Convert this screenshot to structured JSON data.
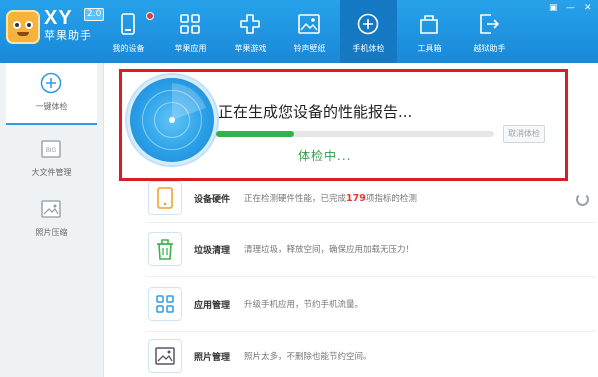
{
  "app": {
    "brand_short": "XY",
    "version": "2.0",
    "brand_name": "苹果助手"
  },
  "nav": [
    {
      "label": "我的设备",
      "icon": "phone-icon",
      "badge": true
    },
    {
      "label": "苹果应用",
      "icon": "apps-grid-icon"
    },
    {
      "label": "苹果游戏",
      "icon": "game-cross-icon"
    },
    {
      "label": "铃声壁纸",
      "icon": "picture-icon"
    },
    {
      "label": "手机体检",
      "icon": "plus-circle-icon",
      "active": true
    },
    {
      "label": "工具箱",
      "icon": "toolbox-icon"
    },
    {
      "label": "越狱助手",
      "icon": "exit-icon"
    }
  ],
  "window_controls": {
    "skin": "▣",
    "minimize": "—",
    "close": "✕"
  },
  "sidebar": [
    {
      "label": "一键体检",
      "icon": "plus-circle-icon",
      "active": true
    },
    {
      "label": "大文件管理",
      "icon": "big-file-icon"
    },
    {
      "label": "照片压缩",
      "icon": "photo-icon"
    }
  ],
  "scan": {
    "title": "正在生成您设备的性能报告...",
    "progress": 0.28,
    "cancel_label": "取消体检",
    "status": "体检中..."
  },
  "rows": [
    {
      "name": "设备硬件",
      "desc_before": "正在检测硬件性能，已完成",
      "highlight": "179",
      "desc_after": "项指标的检测",
      "icon": "device-hardware-icon"
    },
    {
      "name": "垃圾清理",
      "desc": "清理垃圾，释放空间，确保应用加载无压力！",
      "icon": "trash-icon"
    },
    {
      "name": "应用管理",
      "desc": "升级手机应用，节约手机流量。",
      "icon": "app-manage-icon"
    },
    {
      "name": "照片管理",
      "desc": "照片太多，不删除也能节约空间。",
      "icon": "photo-manage-icon"
    }
  ],
  "colors": {
    "header": "#1988d8",
    "active_nav": "#1478c2",
    "progress_fill": "#33b24a",
    "highlight_box": "#d81e20",
    "status_text": "#2e9e49"
  }
}
